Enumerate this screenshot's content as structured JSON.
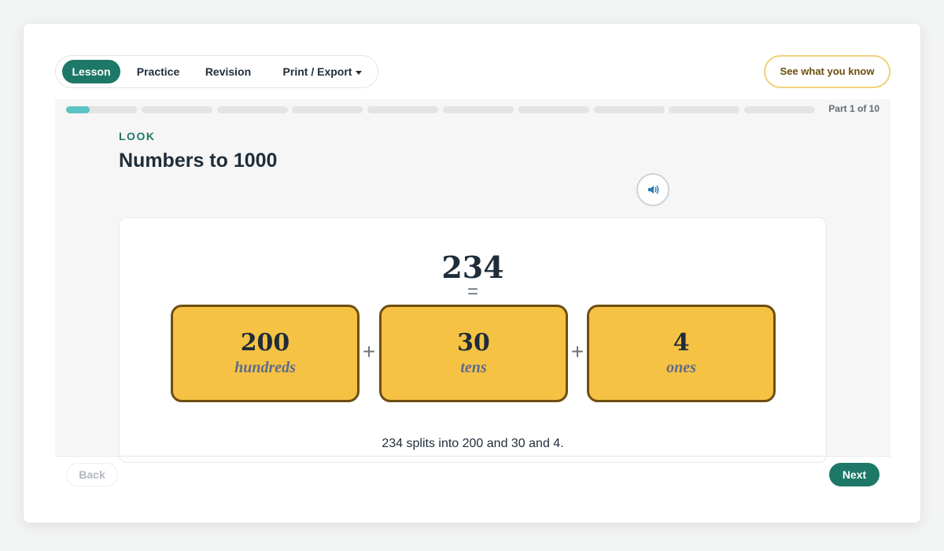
{
  "tabs": [
    {
      "label": "Lesson",
      "active": true
    },
    {
      "label": "Practice",
      "active": false
    },
    {
      "label": "Revision",
      "active": false
    },
    {
      "label": "Print / Export",
      "active": false
    }
  ],
  "know_button": "See what you know",
  "progress": {
    "label": "Part 1 of 10",
    "current": 1,
    "total": 10,
    "current_fill": 0.33
  },
  "lesson": {
    "eyebrow": "LOOK",
    "title": "Numbers to 1000",
    "number": "234",
    "equals": "=",
    "plus": "+",
    "parts": [
      {
        "value": "200",
        "unit": "hundreds"
      },
      {
        "value": "30",
        "unit": "tens"
      },
      {
        "value": "4",
        "unit": "ones"
      }
    ],
    "caption": "234 splits into 200 and 30 and 4."
  },
  "nav": {
    "back": "Back",
    "next": "Next"
  },
  "colors": {
    "accent": "#1d7868",
    "progress": "#5ec3c4",
    "box_fill": "#f5c244",
    "box_border": "#6e4e12",
    "highlight_border": "#f1d27a"
  },
  "icons": {
    "audio": "speaker-icon",
    "dropdown": "chevron-down-icon"
  }
}
